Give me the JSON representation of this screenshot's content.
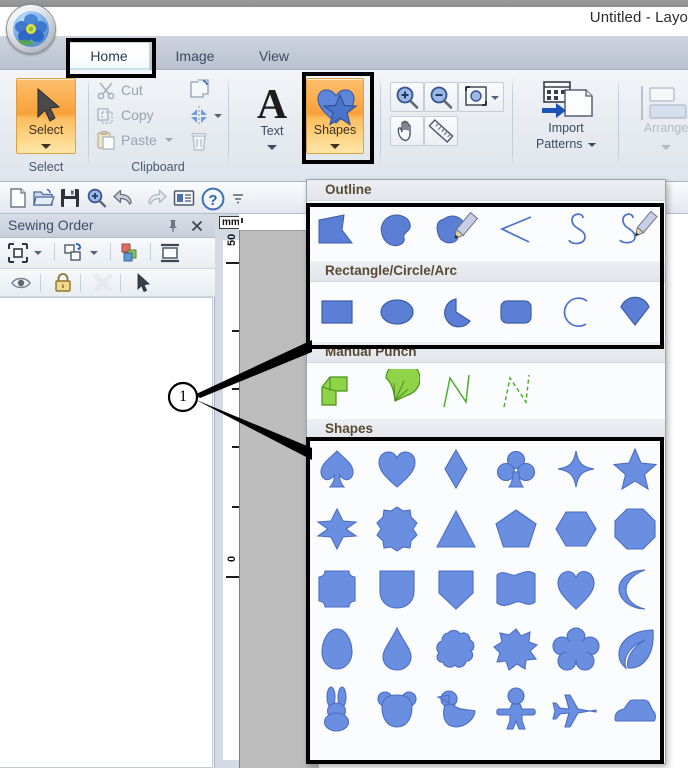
{
  "window": {
    "title": "Untitled - Layo"
  },
  "tabs": [
    {
      "label": "Home",
      "active": true
    },
    {
      "label": "Image",
      "active": false
    },
    {
      "label": "View",
      "active": false
    }
  ],
  "ribbon": {
    "groups": [
      {
        "name": "select",
        "label": "Select"
      },
      {
        "name": "clipboard",
        "label": "Clipboard"
      },
      {
        "name": "tools",
        "label": ""
      },
      {
        "name": "zoom",
        "label": ""
      },
      {
        "name": "import",
        "label": ""
      },
      {
        "name": "arrange",
        "label": ""
      }
    ],
    "select": {
      "button_label": "Select",
      "group_label": "Select",
      "icon": "arrow-cursor-icon"
    },
    "clipboard": {
      "group_label": "Clipboard",
      "items": [
        {
          "label": "Cut",
          "icon": "scissors-icon"
        },
        {
          "label": "Copy",
          "icon": "copy-icon"
        },
        {
          "label": "Paste",
          "icon": "clipboard-icon",
          "has_caret": true
        }
      ],
      "side_items": [
        {
          "label": "",
          "icon": "duplicate-icon"
        },
        {
          "label": "",
          "icon": "mirror-icon",
          "has_caret": true
        },
        {
          "label": "",
          "icon": "trash-icon"
        }
      ]
    },
    "text": {
      "label": "Text",
      "icon": "letter-a-icon",
      "has_caret": true
    },
    "shapes": {
      "label": "Shapes",
      "icon": "heart-star-icon",
      "has_caret": true,
      "highlighted": true
    },
    "zoom": {
      "items": [
        {
          "icon": "zoom-in-icon"
        },
        {
          "icon": "zoom-out-icon"
        },
        {
          "icon": "zoom-fit-icon",
          "has_caret": true
        },
        {
          "icon": "pan-hand-icon"
        },
        {
          "icon": "measure-ruler-icon"
        }
      ]
    },
    "import": {
      "label_line1": "Import",
      "label_line2": "Patterns",
      "icon": "import-patterns-icon",
      "has_caret": true
    },
    "arrange": {
      "label": "Arrange",
      "icon": "arrange-icon",
      "has_caret": true,
      "disabled": true
    }
  },
  "quick_access": {
    "items": [
      {
        "icon": "new-document-icon"
      },
      {
        "icon": "open-folder-icon"
      },
      {
        "icon": "save-disk-icon"
      },
      {
        "icon": "zoom-icon"
      },
      {
        "icon": "undo-icon"
      },
      {
        "icon": "redo-icon"
      },
      {
        "icon": "properties-icon"
      },
      {
        "icon": "help-icon"
      },
      {
        "icon": "overflow-chevron-icon"
      }
    ]
  },
  "sewing_order": {
    "title": "Sewing Order",
    "pin_icon": "pin-icon",
    "close_icon": "close-x-icon",
    "toolbar_row1": [
      {
        "icon": "select-all-frame-icon",
        "has_caret": true
      },
      {
        "icon": "reorder-icon",
        "has_caret": true
      },
      {
        "icon": "color-group-icon"
      },
      {
        "icon": "block-icon"
      }
    ],
    "toolbar_row2": [
      {
        "icon": "eye-visibility-icon"
      },
      {
        "icon": "lock-icon"
      },
      {
        "icon": "delete-x-icon"
      },
      {
        "icon": "pointer-icon"
      }
    ]
  },
  "ruler": {
    "unit": "mm",
    "labels": [
      "50",
      "0"
    ]
  },
  "callout": {
    "number": "1"
  },
  "shapes_panel": {
    "sections": [
      {
        "id": "outline",
        "title": "Outline",
        "highlighted": true,
        "rows": [
          [
            {
              "name": "outline-polygon",
              "icon": "polygon-shape-icon"
            },
            {
              "name": "outline-blob",
              "icon": "blob-shape-icon"
            },
            {
              "name": "outline-blob-pencil",
              "icon": "blob-pencil-icon"
            },
            {
              "name": "outline-zigzag-line",
              "icon": "zigzag-line-icon"
            },
            {
              "name": "outline-curve",
              "icon": "s-curve-icon"
            },
            {
              "name": "outline-curve-pencil",
              "icon": "curve-pencil-icon"
            }
          ]
        ]
      },
      {
        "id": "rectangle-circle-arc",
        "title": "Rectangle/Circle/Arc",
        "highlighted": true,
        "rows": [
          [
            {
              "name": "rectangle",
              "icon": "rectangle-icon"
            },
            {
              "name": "ellipse",
              "icon": "ellipse-icon"
            },
            {
              "name": "pie-wedge",
              "icon": "pie-wedge-icon"
            },
            {
              "name": "rounded-rectangle",
              "icon": "rounded-rectangle-icon"
            },
            {
              "name": "arc",
              "icon": "arc-icon"
            },
            {
              "name": "arc-chord",
              "icon": "arc-chord-icon"
            }
          ]
        ]
      },
      {
        "id": "manual-punch",
        "title": "Manual Punch",
        "highlighted": false,
        "rows": [
          [
            {
              "name": "manual-punch-block",
              "icon": "punch-block-icon"
            },
            {
              "name": "manual-punch-fan",
              "icon": "punch-fan-icon"
            },
            {
              "name": "manual-punch-run",
              "icon": "punch-run-icon"
            },
            {
              "name": "manual-punch-dashed-run",
              "icon": "punch-dashed-run-icon"
            }
          ]
        ]
      },
      {
        "id": "shapes",
        "title": "Shapes",
        "highlighted": true,
        "rows": [
          [
            {
              "name": "shape-spade",
              "icon": "spade-icon"
            },
            {
              "name": "shape-heart",
              "icon": "heart-icon"
            },
            {
              "name": "shape-diamond",
              "icon": "diamond-icon"
            },
            {
              "name": "shape-club",
              "icon": "club-icon"
            },
            {
              "name": "shape-sparkle",
              "icon": "four-point-star-icon"
            },
            {
              "name": "shape-star",
              "icon": "five-point-star-icon"
            }
          ],
          [
            {
              "name": "shape-six-point-star",
              "icon": "six-point-star-icon"
            },
            {
              "name": "shape-eight-point-star",
              "icon": "eight-point-star-icon"
            },
            {
              "name": "shape-triangle",
              "icon": "triangle-icon"
            },
            {
              "name": "shape-pentagon",
              "icon": "pentagon-icon"
            },
            {
              "name": "shape-hexagon",
              "icon": "hexagon-icon"
            },
            {
              "name": "shape-octagon",
              "icon": "octagon-icon"
            }
          ],
          [
            {
              "name": "shape-concave-square",
              "icon": "concave-square-icon"
            },
            {
              "name": "shape-shield-round",
              "icon": "round-shield-icon"
            },
            {
              "name": "shape-shield-point",
              "icon": "pointed-shield-icon"
            },
            {
              "name": "shape-banner",
              "icon": "wavy-banner-icon"
            },
            {
              "name": "shape-heart-2",
              "icon": "heart-outline-icon"
            },
            {
              "name": "shape-moon",
              "icon": "crescent-moon-icon"
            }
          ],
          [
            {
              "name": "shape-egg",
              "icon": "egg-icon"
            },
            {
              "name": "shape-teardrop",
              "icon": "teardrop-icon"
            },
            {
              "name": "shape-cloud",
              "icon": "cloud-icon"
            },
            {
              "name": "shape-burst",
              "icon": "burst-icon"
            },
            {
              "name": "shape-flower",
              "icon": "flower-icon"
            },
            {
              "name": "shape-leaf",
              "icon": "leaf-icon"
            }
          ],
          [
            {
              "name": "shape-rabbit",
              "icon": "rabbit-icon"
            },
            {
              "name": "shape-bear",
              "icon": "bear-icon"
            },
            {
              "name": "shape-duck",
              "icon": "duck-icon"
            },
            {
              "name": "shape-gingerbread-man",
              "icon": "gingerbread-man-icon"
            },
            {
              "name": "shape-airplane",
              "icon": "airplane-icon"
            },
            {
              "name": "shape-car",
              "icon": "car-icon"
            }
          ]
        ]
      }
    ]
  },
  "colors": {
    "shape_blue": "#5b7fd4",
    "shape_blue_light": "#7d9aea",
    "punch_green": "#7ac943",
    "accent_orange": "#f8a13a",
    "highlight_black": "#000000"
  }
}
